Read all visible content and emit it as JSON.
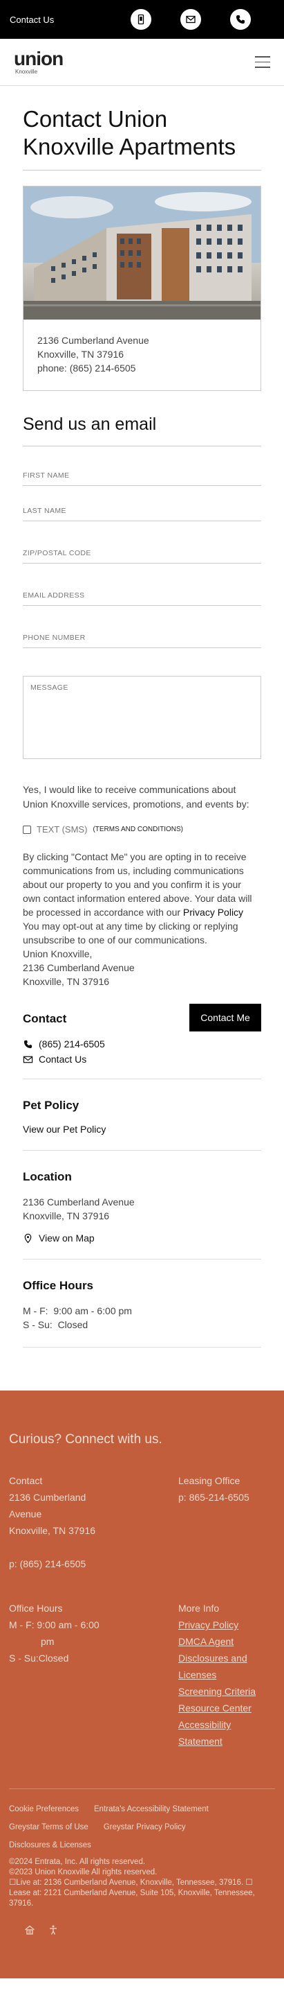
{
  "topbar": {
    "title": "Contact Us"
  },
  "header": {
    "logo_main": "union",
    "logo_sub": "Knoxville"
  },
  "page_title": "Contact Union Knoxville Apartments",
  "property": {
    "address1": "2136 Cumberland Avenue",
    "address2": "Knoxville, TN 37916",
    "phone": "phone: (865) 214-6505"
  },
  "email_section": {
    "title": "Send us an email",
    "first_name": "FIRST NAME",
    "last_name": "LAST NAME",
    "zip": "ZIP/POSTAL CODE",
    "email": "EMAIL ADDRESS",
    "phone": "PHONE NUMBER",
    "message": "MESSAGE",
    "opt_text": "Yes, I would like to receive communications about Union Knoxville services, promotions, and events by:",
    "sms_label": "TEXT (SMS)",
    "sms_terms": "(TERMS AND CONDITIONS)",
    "consent_1": "By clicking \"Contact Me\" you are opting in to receive communications from us, including communications about our property to you and you confirm it is your own contact information entered above. Your data will be processed in accordance with our",
    "consent_link": "Privacy Policy",
    "consent_2": "You may opt-out at any time by clicking or replying unsubscribe to one of our communications.",
    "consent_name": "Union Knoxville,",
    "consent_addr1": "2136 Cumberland Avenue",
    "consent_addr2": "Knoxville, TN 37916"
  },
  "contact_block": {
    "title": "Contact",
    "button": "Contact Me",
    "phone": "(865) 214-6505",
    "contact_us": "Contact Us"
  },
  "pet_block": {
    "title": "Pet Policy",
    "link": "View our Pet Policy"
  },
  "location_block": {
    "title": "Location",
    "address1": "2136 Cumberland Avenue",
    "address2": "Knoxville, TN 37916",
    "map": "View on Map"
  },
  "hours_block": {
    "title": "Office Hours",
    "line1": "M - F:  9:00 am - 6:00 pm",
    "line2": "S - Su:  Closed"
  },
  "footer": {
    "heading": "Curious? Connect with us.",
    "contact_h": "Contact",
    "addr1": "2136 Cumberland",
    "addr2": "Avenue",
    "addr3": "Knoxville, TN 37916",
    "phone": "p: (865) 214-6505",
    "leasing_h": "Leasing Office",
    "leasing_phone": "p: 865-214-6505",
    "hours_h": "Office Hours",
    "hours_1": "M - F: 9:00 am - 6:00",
    "hours_1b": "pm",
    "hours_2": "S - Su:Closed",
    "more_h": "More Info",
    "more_links": [
      "Privacy Policy",
      "DMCA Agent",
      "Disclosures and",
      "Licenses",
      "Screening Criteria",
      "Resource Center",
      "Accessibility",
      "Statement"
    ],
    "links": [
      "Cookie Preferences",
      "Entrata's Accessibility Statement",
      "Greystar Terms of Use",
      "Greystar Privacy Policy",
      "Disclosures & Licenses"
    ],
    "copy_1": "©2024 Entrata, Inc. All rights reserved.",
    "copy_2": "©2023 Union Knoxville All rights reserved.",
    "copy_3": "☐Live at: 2136 Cumberland Avenue, Knoxville, Tennessee, 37916. ☐",
    "copy_4": "Lease at: 2121 Cumberland Avenue, Suite 105, Knoxville, Tennessee,",
    "copy_5": "37916."
  }
}
